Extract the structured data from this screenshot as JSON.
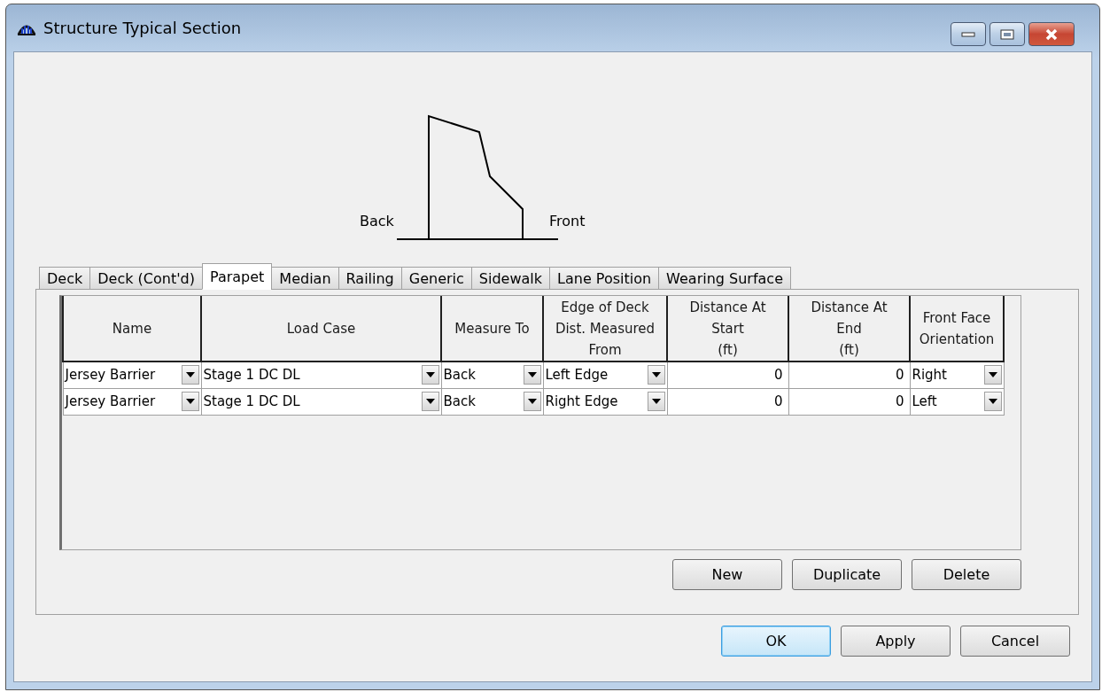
{
  "window": {
    "title": "Structure Typical Section"
  },
  "diagram": {
    "back_label": "Back",
    "front_label": "Front"
  },
  "tabs": [
    {
      "label": "Deck",
      "selected": false
    },
    {
      "label": "Deck (Cont'd)",
      "selected": false
    },
    {
      "label": "Parapet",
      "selected": true
    },
    {
      "label": "Median",
      "selected": false
    },
    {
      "label": "Railing",
      "selected": false
    },
    {
      "label": "Generic",
      "selected": false
    },
    {
      "label": "Sidewalk",
      "selected": false
    },
    {
      "label": "Lane Position",
      "selected": false
    },
    {
      "label": "Wearing Surface",
      "selected": false
    }
  ],
  "table": {
    "columns": [
      {
        "label": "Name",
        "kind": "combo"
      },
      {
        "label": "Load Case",
        "kind": "combo"
      },
      {
        "label": "Measure To",
        "kind": "combo"
      },
      {
        "label": "Edge of Deck\nDist. Measured\nFrom",
        "kind": "combo"
      },
      {
        "label": "Distance At\nStart\n(ft)",
        "kind": "number"
      },
      {
        "label": "Distance At\nEnd\n(ft)",
        "kind": "number"
      },
      {
        "label": "Front Face\nOrientation",
        "kind": "combo"
      }
    ],
    "rows": [
      {
        "cells": [
          "Jersey Barrier",
          "Stage 1 DC DL",
          "Back",
          "Left Edge",
          "0",
          "0",
          "Right"
        ]
      },
      {
        "cells": [
          "Jersey Barrier",
          "Stage 1 DC DL",
          "Back",
          "Right Edge",
          "0",
          "0",
          "Left"
        ]
      }
    ]
  },
  "table_buttons": [
    "New",
    "Duplicate",
    "Delete"
  ],
  "dialog_buttons": [
    {
      "label": "OK",
      "default": true
    },
    {
      "label": "Apply",
      "default": false
    },
    {
      "label": "Cancel",
      "default": false
    }
  ]
}
